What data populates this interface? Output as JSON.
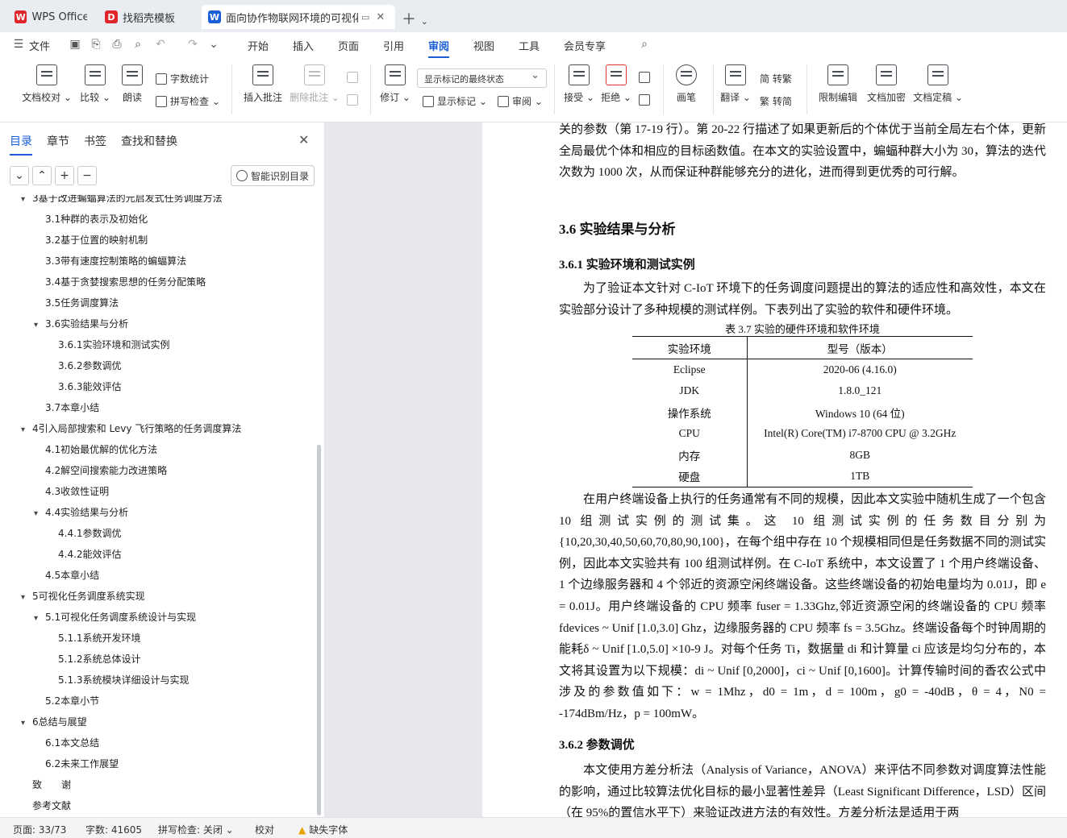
{
  "tabs": [
    {
      "label": "WPS Office",
      "icon": "wps-logo-icon",
      "color": "#e0262b"
    },
    {
      "label": "找稻壳模板",
      "icon": "docer-logo-icon",
      "color": "#e0262b"
    },
    {
      "label": "面向协作物联网环境的可视化",
      "icon": "word-doc-icon",
      "color": "#1a5fd8"
    }
  ],
  "menu": {
    "file": "文件",
    "items": [
      "开始",
      "插入",
      "页面",
      "引用",
      "审阅",
      "视图",
      "工具",
      "会员专享"
    ],
    "active": "审阅"
  },
  "ribbon": {
    "buttons": [
      {
        "label": "文档校对 ⌄",
        "name": "proofread-button"
      },
      {
        "label": "比较 ⌄",
        "name": "compare-button"
      },
      {
        "label": "朗读",
        "name": "read-aloud-button"
      },
      {
        "label": "插入批注",
        "name": "insert-comment-button"
      },
      {
        "label": "删除批注 ⌄",
        "name": "delete-comment-button"
      },
      {
        "label": "修订 ⌄",
        "name": "track-changes-button"
      },
      {
        "label": "接受 ⌄",
        "name": "accept-button"
      },
      {
        "label": "拒绝 ⌄",
        "name": "reject-button"
      },
      {
        "label": "画笔",
        "name": "pen-button"
      },
      {
        "label": "翻译 ⌄",
        "name": "translate-button"
      },
      {
        "label": "限制编辑",
        "name": "restrict-editing-button"
      },
      {
        "label": "文档加密",
        "name": "encrypt-button"
      },
      {
        "label": "文档定稿 ⌄",
        "name": "finalize-button"
      }
    ],
    "small": {
      "word_count": "字数统计",
      "spell_check": "拼写检查 ⌄",
      "show_markup": "显示标记 ⌄",
      "review_pane": "审阅 ⌄",
      "trad_to_simp": "繁 转简",
      "simp_to_trad": "简 转繁"
    },
    "markup_select": "显示标记的最终状态"
  },
  "sidebar": {
    "tabs": [
      "目录",
      "章节",
      "书签",
      "查找和替换"
    ],
    "active_tab": "目录",
    "smart_toc": "智能识别目录",
    "toc": [
      {
        "label": "3基于改进蝙蝠算法的元启发式任务调度方法",
        "level": 1,
        "arrow": "▾"
      },
      {
        "label": "3.1种群的表示及初始化",
        "level": 2,
        "arrow": ""
      },
      {
        "label": "3.2基于位置的映射机制",
        "level": 2,
        "arrow": ""
      },
      {
        "label": "3.3带有速度控制策略的蝙蝠算法",
        "level": 2,
        "arrow": ""
      },
      {
        "label": "3.4基于贪婪搜索思想的任务分配策略",
        "level": 2,
        "arrow": ""
      },
      {
        "label": "3.5任务调度算法",
        "level": 2,
        "arrow": ""
      },
      {
        "label": "3.6实验结果与分析",
        "level": 2,
        "arrow": "▾"
      },
      {
        "label": "3.6.1实验环境和测试实例",
        "level": 3,
        "arrow": ""
      },
      {
        "label": "3.6.2参数调优",
        "level": 3,
        "arrow": ""
      },
      {
        "label": "3.6.3能效评估",
        "level": 3,
        "arrow": ""
      },
      {
        "label": "3.7本章小结",
        "level": 2,
        "arrow": ""
      },
      {
        "label": "4引入局部搜索和 Levy 飞行策略的任务调度算法",
        "level": 1,
        "arrow": "▾"
      },
      {
        "label": "4.1初始最优解的优化方法",
        "level": 2,
        "arrow": ""
      },
      {
        "label": "4.2解空间搜索能力改进策略",
        "level": 2,
        "arrow": ""
      },
      {
        "label": "4.3收敛性证明",
        "level": 2,
        "arrow": ""
      },
      {
        "label": "4.4实验结果与分析",
        "level": 2,
        "arrow": "▾"
      },
      {
        "label": "4.4.1参数调优",
        "level": 3,
        "arrow": ""
      },
      {
        "label": "4.4.2能效评估",
        "level": 3,
        "arrow": ""
      },
      {
        "label": "4.5本章小结",
        "level": 2,
        "arrow": ""
      },
      {
        "label": "5可视化任务调度系统实现",
        "level": 1,
        "arrow": "▾"
      },
      {
        "label": "5.1可视化任务调度系统设计与实现",
        "level": 2,
        "arrow": "▾"
      },
      {
        "label": "5.1.1系统开发环境",
        "level": 3,
        "arrow": ""
      },
      {
        "label": "5.1.2系统总体设计",
        "level": 3,
        "arrow": ""
      },
      {
        "label": "5.1.3系统模块详细设计与实现",
        "level": 3,
        "arrow": ""
      },
      {
        "label": "5.2本章小节",
        "level": 2,
        "arrow": ""
      },
      {
        "label": "6总结与展望",
        "level": 1,
        "arrow": "▾"
      },
      {
        "label": "6.1本文总结",
        "level": 2,
        "arrow": ""
      },
      {
        "label": "6.2未来工作展望",
        "level": 2,
        "arrow": ""
      },
      {
        "label": "致　　谢",
        "level": 1,
        "arrow": ""
      },
      {
        "label": "参考文献",
        "level": 1,
        "arrow": ""
      }
    ]
  },
  "doc": {
    "p1": "关的参数（第 17-19 行）。第 20-22 行描述了如果更新后的个体优于当前全局左右个体，更新全局最优个体和相应的目标函数值。在本文的实验设置中，蝙蝠种群大小为 30，算法的迭代次数为 1000 次，从而保证种群能够充分的进化，进而得到更优秀的可行解。",
    "h_36": "3.6  实验结果与分析",
    "h_361": "3.6.1  实验环境和测试实例",
    "p2": "为了验证本文针对 C-IoT 环境下的任务调度问题提出的算法的适应性和高效性，本文在实验部分设计了多种规模的测试样例。下表列出了实验的软件和硬件环境。",
    "table_caption": "表 3.7  实验的硬件环境和软件环境",
    "table_headers": [
      "实验环境",
      "型号（版本）"
    ],
    "table_rows": [
      [
        "Eclipse",
        "2020-06 (4.16.0)"
      ],
      [
        "JDK",
        "1.8.0_121"
      ],
      [
        "操作系统",
        "Windows 10 (64 位)"
      ],
      [
        "CPU",
        "Intel(R) Core(TM) i7-8700 CPU @ 3.2GHz"
      ],
      [
        "内存",
        "8GB"
      ],
      [
        "硬盘",
        "1TB"
      ]
    ],
    "p3": "在用户终端设备上执行的任务通常有不同的规模，因此本文实验中随机生成了一个包含 10 组测试实例的测试集。这 10 组测试实例的任务数目分别为{10,20,30,40,50,60,70,80,90,100}，在每个组中存在 10 个规模相同但是任务数据不同的测试实例，因此本文实验共有 100 组测试样例。在 C-IoT 系统中，本文设置了 1 个用户终端设备、1 个边缘服务器和 4 个邻近的资源空闲终端设备。这些终端设备的初始电量均为 0.01J，即 e = 0.01J。用户终端设备的 CPU 频率 fuser = 1.33Ghz,邻近资源空闲的终端设备的 CPU 频率 fdevices ~ Unif [1.0,3.0] Ghz，边缘服务器的 CPU 频率 fs = 3.5Ghz。终端设备每个时钟周期的能耗δ ~ Unif [1.0,5.0] ×10-9 J。对每个任务 Ti，数据量 di 和计算量 ci 应该是均匀分布的，本文将其设置为以下规模：di ~ Unif [0,2000]，ci ~ Unif [0,1600]。计算传输时间的香农公式中涉及的参数值如下：w = 1Mhz，d0 = 1m，d = 100m，g0 = -40dB，θ = 4，N0 = -174dBm/Hz，p = 100mW。",
    "h_362": "3.6.2  参数调优",
    "p4": "本文使用方差分析法（Analysis of Variance，ANOVA）来评估不同参数对调度算法性能的影响，通过比较算法优化目标的最小显著性差异（Least Significant Difference，LSD）区间（在 95%的置信水平下）来验证改进方法的有效性。方差分析法是适用于两"
  },
  "status": {
    "page": "页面: 33/73",
    "words": "字数: 41605",
    "spell": "拼写检查: 关闭 ⌄",
    "proof": "校对",
    "missing_font": "缺失字体"
  }
}
